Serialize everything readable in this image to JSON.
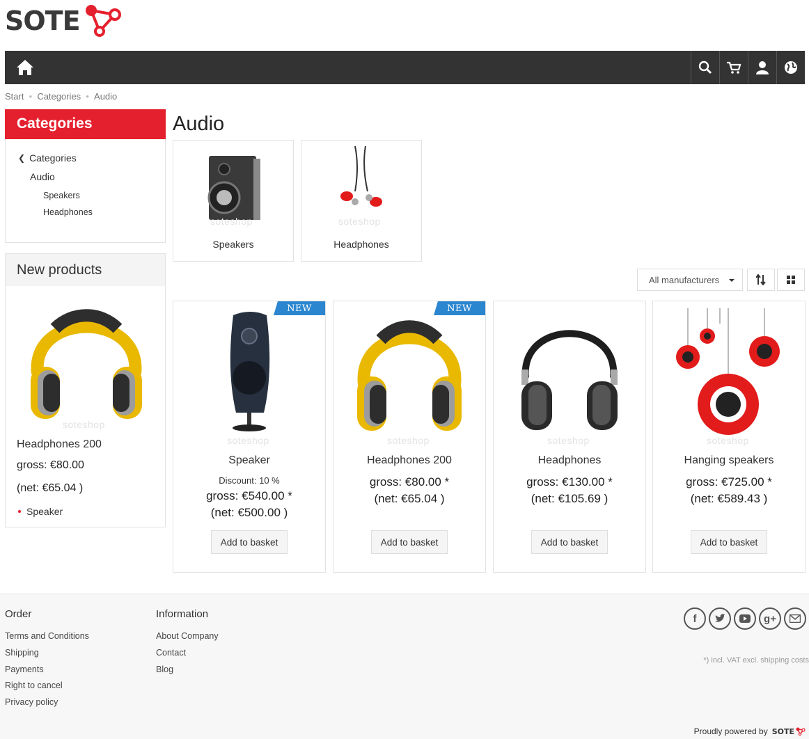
{
  "brand": {
    "logo_text": "SOTE",
    "accent": "#e5202e"
  },
  "navbar": {
    "home_icon": "home-icon",
    "icons": [
      "search-icon",
      "cart-icon",
      "user-icon",
      "globe-icon"
    ]
  },
  "breadcrumb": [
    "Start",
    "Categories",
    "Audio"
  ],
  "sidebar": {
    "categories_title": "Categories",
    "tree": {
      "back": "Categories",
      "current": "Audio",
      "children": [
        "Speakers",
        "Headphones"
      ]
    },
    "new_products": {
      "title": "New products",
      "product": {
        "name": "Headphones 200",
        "gross": "gross: €80.00",
        "net": "(net: €65.04 )",
        "tag": "Speaker",
        "watermark": "soteshop"
      }
    }
  },
  "main": {
    "title": "Audio",
    "subcategories": [
      {
        "label": "Speakers",
        "watermark": "soteshop"
      },
      {
        "label": "Headphones",
        "watermark": "soteshop"
      }
    ],
    "toolbar": {
      "manufacturer": "All manufacturers",
      "sort_icon": "sort-icon",
      "grid_icon": "grid-view-icon"
    },
    "products": [
      {
        "name": "Speaker",
        "badge": "NEW",
        "discount": "Discount: 10 %",
        "gross": "gross: €540.00 *",
        "net": "(net: €500.00 )",
        "button": "Add to basket",
        "watermark": "soteshop"
      },
      {
        "name": "Headphones 200",
        "badge": "NEW",
        "discount": "",
        "gross": "gross: €80.00 *",
        "net": "(net: €65.04 )",
        "button": "Add to basket",
        "watermark": "soteshop"
      },
      {
        "name": "Headphones",
        "badge": "",
        "discount": "",
        "gross": "gross: €130.00 *",
        "net": "(net: €105.69 )",
        "button": "Add to basket",
        "watermark": "soteshop"
      },
      {
        "name": "Hanging speakers",
        "badge": "",
        "discount": "",
        "gross": "gross: €725.00 *",
        "net": "(net: €589.43 )",
        "button": "Add to basket",
        "watermark": "soteshop"
      }
    ]
  },
  "footer": {
    "order": {
      "title": "Order",
      "links": [
        "Terms and Conditions",
        "Shipping",
        "Payments",
        "Right to cancel",
        "Privacy policy"
      ]
    },
    "information": {
      "title": "Information",
      "links": [
        "About Company",
        "Contact",
        "Blog"
      ]
    },
    "socials": [
      "facebook-icon",
      "twitter-icon",
      "youtube-icon",
      "google-plus-icon",
      "email-icon"
    ],
    "vat_note": "*) incl. VAT excl. shipping costs",
    "powered_by": "Proudly powered by",
    "powered_logo": "SOTE"
  }
}
